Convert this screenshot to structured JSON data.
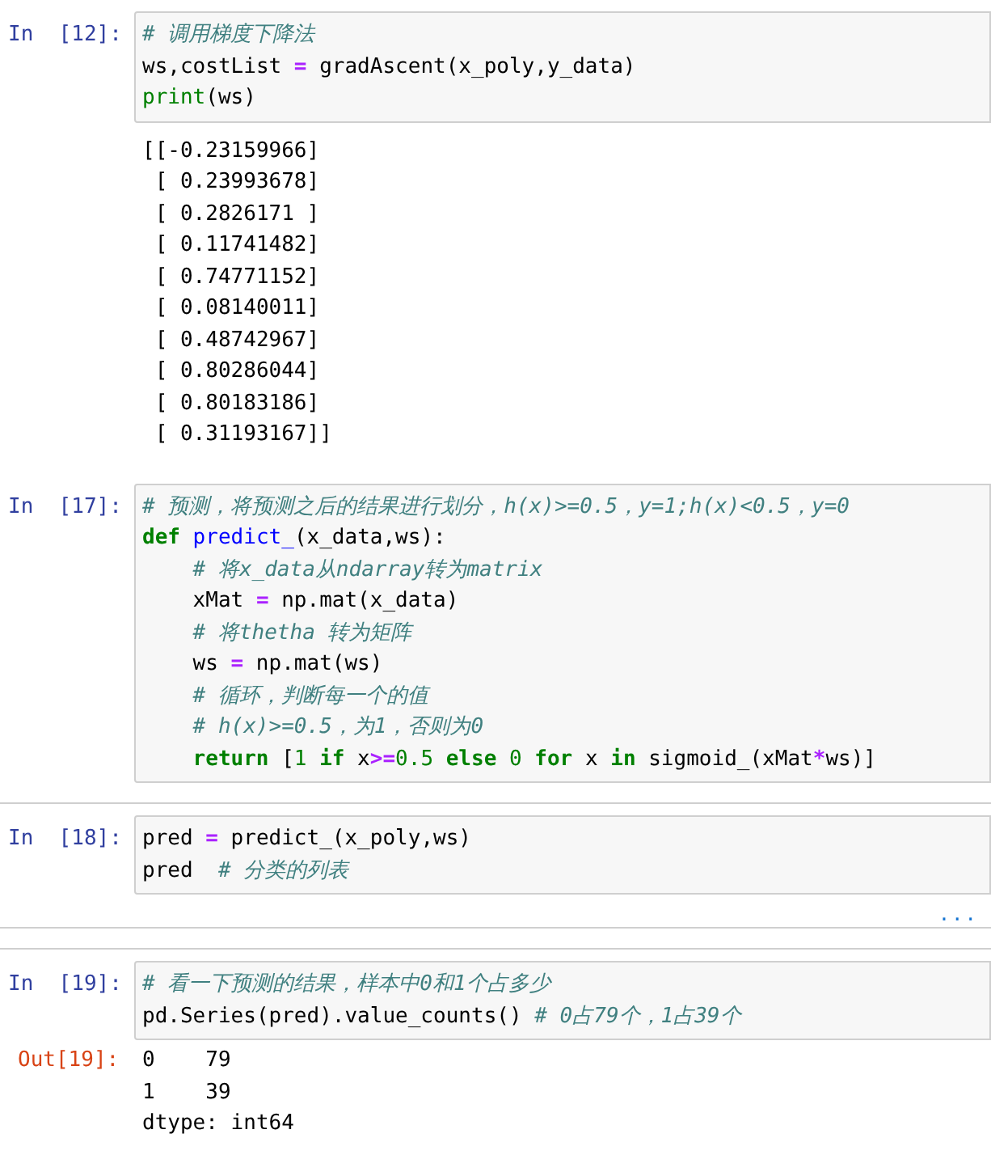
{
  "cells": [
    {
      "prompt": "In  [12]:",
      "input": [
        {
          "indented": false,
          "segments": [
            {
              "kind": "comment",
              "text": "# 调用梯度下降法"
            }
          ]
        },
        {
          "indented": false,
          "segments": [
            {
              "kind": "plain",
              "text": "ws,costList "
            },
            {
              "kind": "op",
              "text": "="
            },
            {
              "kind": "plain",
              "text": " gradAscent(x_poly,y_data)"
            }
          ]
        },
        {
          "indented": false,
          "segments": [
            {
              "kind": "builtin",
              "text": "print"
            },
            {
              "kind": "plain",
              "text": "(ws)"
            }
          ]
        }
      ],
      "output": {
        "kind": "stream",
        "lines": [
          "[[-0.23159966]",
          " [ 0.23993678]",
          " [ 0.2826171 ]",
          " [ 0.11741482]",
          " [ 0.74771152]",
          " [ 0.08140011]",
          " [ 0.48742967]",
          " [ 0.80286044]",
          " [ 0.80183186]",
          " [ 0.31193167]]"
        ]
      }
    },
    {
      "prompt": "In  [17]:",
      "input": [
        {
          "indented": false,
          "segments": [
            {
              "kind": "comment",
              "text": "# 预测，将预测之后的结果进行划分，h(x)>=0.5，y=1;h(x)<0.5，y=0"
            }
          ]
        },
        {
          "indented": false,
          "segments": [
            {
              "kind": "keyword",
              "text": "def"
            },
            {
              "kind": "func",
              "text": " predict_"
            },
            {
              "kind": "plain",
              "text": "(x_data,ws):"
            }
          ]
        },
        {
          "indented": true,
          "segments": [
            {
              "kind": "comment",
              "text": "# 将x_data从ndarray转为matrix"
            }
          ]
        },
        {
          "indented": true,
          "segments": [
            {
              "kind": "plain",
              "text": "xMat "
            },
            {
              "kind": "op",
              "text": "="
            },
            {
              "kind": "plain",
              "text": " np.mat(x_data)"
            }
          ]
        },
        {
          "indented": true,
          "segments": [
            {
              "kind": "comment",
              "text": "# 将thetha 转为矩阵"
            }
          ]
        },
        {
          "indented": true,
          "segments": [
            {
              "kind": "plain",
              "text": "ws "
            },
            {
              "kind": "op",
              "text": "="
            },
            {
              "kind": "plain",
              "text": " np.mat(ws)"
            }
          ]
        },
        {
          "indented": true,
          "segments": [
            {
              "kind": "comment",
              "text": "# 循环，判断每一个的值"
            }
          ]
        },
        {
          "indented": true,
          "segments": [
            {
              "kind": "comment",
              "text": "# h(x)>=0.5，为1，否则为0"
            }
          ]
        },
        {
          "indented": true,
          "segments": [
            {
              "kind": "keyword",
              "text": "return"
            },
            {
              "kind": "plain",
              "text": " ["
            },
            {
              "kind": "number",
              "text": "1"
            },
            {
              "kind": "keyword",
              "text": " if"
            },
            {
              "kind": "plain",
              "text": " x"
            },
            {
              "kind": "op",
              "text": ">="
            },
            {
              "kind": "number",
              "text": "0.5"
            },
            {
              "kind": "keyword",
              "text": " else"
            },
            {
              "kind": "number",
              "text": " 0"
            },
            {
              "kind": "keyword",
              "text": " for"
            },
            {
              "kind": "plain",
              "text": " x"
            },
            {
              "kind": "keyword",
              "text": " in"
            },
            {
              "kind": "plain",
              "text": " sigmoid_(xMat"
            },
            {
              "kind": "op",
              "text": "*"
            },
            {
              "kind": "plain",
              "text": "ws)]"
            }
          ]
        }
      ]
    },
    {
      "prompt": "In  [18]:",
      "input": [
        {
          "indented": false,
          "segments": [
            {
              "kind": "plain",
              "text": "pred "
            },
            {
              "kind": "op",
              "text": "="
            },
            {
              "kind": "plain",
              "text": " predict_(x_poly,ws)"
            }
          ]
        },
        {
          "indented": false,
          "segments": [
            {
              "kind": "plain",
              "text": "pred  "
            },
            {
              "kind": "comment",
              "text": "# 分类的列表"
            }
          ]
        }
      ],
      "output": {
        "kind": "collapsed",
        "text": "..."
      }
    },
    {
      "prompt": "In  [19]:",
      "input": [
        {
          "indented": false,
          "segments": [
            {
              "kind": "comment",
              "text": "# 看一下预测的结果，样本中0和1个占多少"
            }
          ]
        },
        {
          "indented": false,
          "segments": [
            {
              "kind": "plain",
              "text": "pd.Series(pred).value_counts() "
            },
            {
              "kind": "comment",
              "text": "# 0占79个，1占39个"
            }
          ]
        }
      ],
      "output": {
        "kind": "result",
        "prompt": "Out[19]:",
        "lines": [
          "0    79",
          "1    39",
          "dtype: int64"
        ]
      }
    }
  ]
}
